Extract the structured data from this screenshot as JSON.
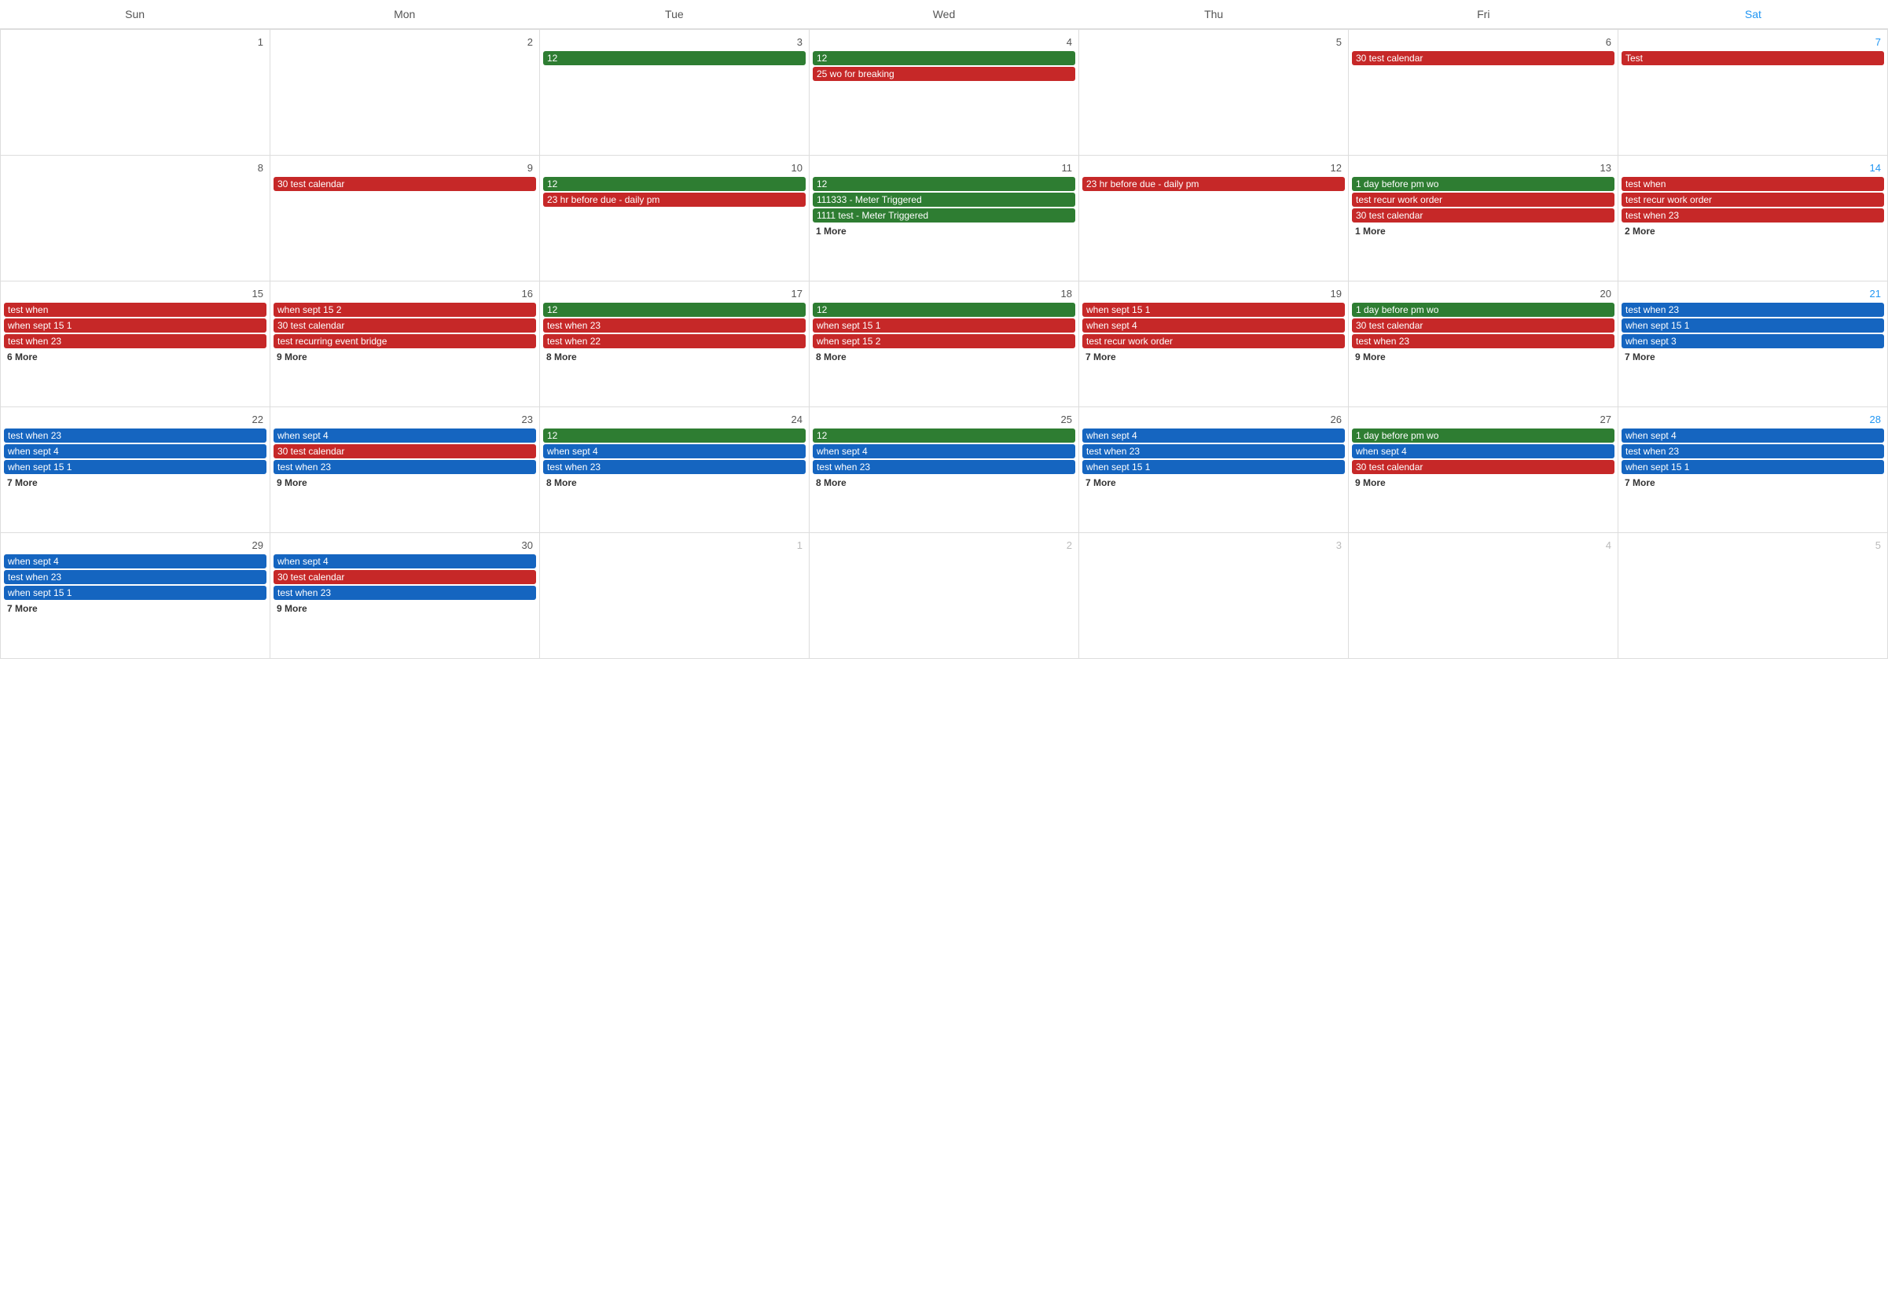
{
  "headers": [
    "Sun",
    "Mon",
    "Tue",
    "Wed",
    "Thu",
    "Fri",
    "Sat"
  ],
  "colors": {
    "green": "#2e7d32",
    "red": "#c62828",
    "blue": "#1565c0",
    "sat": "#2196F3"
  },
  "weeks": [
    {
      "days": [
        {
          "num": "1",
          "otherMonth": false,
          "events": [],
          "more": ""
        },
        {
          "num": "2",
          "otherMonth": false,
          "events": [],
          "more": ""
        },
        {
          "num": "3",
          "otherMonth": false,
          "events": [
            {
              "label": "12",
              "color": "green"
            }
          ],
          "more": ""
        },
        {
          "num": "4",
          "otherMonth": false,
          "events": [
            {
              "label": "12",
              "color": "green"
            },
            {
              "label": "25 wo for breaking",
              "color": "red"
            }
          ],
          "more": ""
        },
        {
          "num": "5",
          "otherMonth": false,
          "events": [],
          "more": ""
        },
        {
          "num": "6",
          "otherMonth": false,
          "events": [
            {
              "label": "30 test calendar",
              "color": "red"
            }
          ],
          "more": ""
        },
        {
          "num": "7",
          "otherMonth": false,
          "events": [
            {
              "label": "Test",
              "color": "red"
            }
          ],
          "more": "",
          "isSat": true
        }
      ]
    },
    {
      "days": [
        {
          "num": "8",
          "otherMonth": false,
          "events": [],
          "more": ""
        },
        {
          "num": "9",
          "otherMonth": false,
          "events": [
            {
              "label": "30 test calendar",
              "color": "red"
            }
          ],
          "more": ""
        },
        {
          "num": "10",
          "otherMonth": false,
          "events": [
            {
              "label": "12",
              "color": "green"
            },
            {
              "label": "23 hr before due - daily pm",
              "color": "red"
            }
          ],
          "more": ""
        },
        {
          "num": "11",
          "otherMonth": false,
          "events": [
            {
              "label": "12",
              "color": "green"
            },
            {
              "label": "111333 - Meter Triggered",
              "color": "green"
            },
            {
              "label": "1111 test - Meter Triggered",
              "color": "green"
            }
          ],
          "more": "1 More"
        },
        {
          "num": "12",
          "otherMonth": false,
          "events": [
            {
              "label": "23 hr before due - daily pm",
              "color": "red"
            }
          ],
          "more": ""
        },
        {
          "num": "13",
          "otherMonth": false,
          "events": [
            {
              "label": "1 day before pm wo",
              "color": "green"
            },
            {
              "label": "test recur work order",
              "color": "red"
            },
            {
              "label": "30 test calendar",
              "color": "red"
            }
          ],
          "more": "1 More"
        },
        {
          "num": "14",
          "otherMonth": false,
          "events": [
            {
              "label": "test when",
              "color": "red"
            },
            {
              "label": "test recur work order",
              "color": "red"
            },
            {
              "label": "test when 23",
              "color": "red"
            }
          ],
          "more": "2 More",
          "isSat": true
        }
      ]
    },
    {
      "days": [
        {
          "num": "15",
          "otherMonth": false,
          "events": [
            {
              "label": "test when",
              "color": "red"
            },
            {
              "label": "when sept 15 1",
              "color": "red"
            },
            {
              "label": "test when 23",
              "color": "red"
            }
          ],
          "more": "6 More"
        },
        {
          "num": "16",
          "otherMonth": false,
          "events": [
            {
              "label": "when sept 15 2",
              "color": "red"
            },
            {
              "label": "30 test calendar",
              "color": "red"
            },
            {
              "label": "test recurring event bridge",
              "color": "red"
            }
          ],
          "more": "9 More"
        },
        {
          "num": "17",
          "otherMonth": false,
          "events": [
            {
              "label": "12",
              "color": "green"
            },
            {
              "label": "test when 23",
              "color": "red"
            },
            {
              "label": "test when 22",
              "color": "red"
            }
          ],
          "more": "8 More"
        },
        {
          "num": "18",
          "otherMonth": false,
          "events": [
            {
              "label": "12",
              "color": "green"
            },
            {
              "label": "when sept 15 1",
              "color": "red"
            },
            {
              "label": "when sept 15 2",
              "color": "red"
            }
          ],
          "more": "8 More"
        },
        {
          "num": "19",
          "otherMonth": false,
          "events": [
            {
              "label": "when sept 15 1",
              "color": "red"
            },
            {
              "label": "when sept 4",
              "color": "red"
            },
            {
              "label": "test recur work order",
              "color": "red"
            }
          ],
          "more": "7 More"
        },
        {
          "num": "20",
          "otherMonth": false,
          "events": [
            {
              "label": "1 day before pm wo",
              "color": "green"
            },
            {
              "label": "30 test calendar",
              "color": "red"
            },
            {
              "label": "test when 23",
              "color": "red"
            }
          ],
          "more": "9 More"
        },
        {
          "num": "21",
          "otherMonth": false,
          "events": [
            {
              "label": "test when 23",
              "color": "blue"
            },
            {
              "label": "when sept 15 1",
              "color": "blue"
            },
            {
              "label": "when sept 3",
              "color": "blue"
            }
          ],
          "more": "7 More",
          "isSat": true
        }
      ]
    },
    {
      "days": [
        {
          "num": "22",
          "otherMonth": false,
          "events": [
            {
              "label": "test when 23",
              "color": "blue"
            },
            {
              "label": "when sept 4",
              "color": "blue"
            },
            {
              "label": "when sept 15 1",
              "color": "blue"
            }
          ],
          "more": "7 More"
        },
        {
          "num": "23",
          "otherMonth": false,
          "events": [
            {
              "label": "when sept 4",
              "color": "blue"
            },
            {
              "label": "30 test calendar",
              "color": "red"
            },
            {
              "label": "test when 23",
              "color": "blue"
            }
          ],
          "more": "9 More"
        },
        {
          "num": "24",
          "otherMonth": false,
          "events": [
            {
              "label": "12",
              "color": "green"
            },
            {
              "label": "when sept 4",
              "color": "blue"
            },
            {
              "label": "test when 23",
              "color": "blue"
            }
          ],
          "more": "8 More"
        },
        {
          "num": "25",
          "otherMonth": false,
          "events": [
            {
              "label": "12",
              "color": "green"
            },
            {
              "label": "when sept 4",
              "color": "blue"
            },
            {
              "label": "test when 23",
              "color": "blue"
            }
          ],
          "more": "8 More"
        },
        {
          "num": "26",
          "otherMonth": false,
          "events": [
            {
              "label": "when sept 4",
              "color": "blue"
            },
            {
              "label": "test when 23",
              "color": "blue"
            },
            {
              "label": "when sept 15 1",
              "color": "blue"
            }
          ],
          "more": "7 More"
        },
        {
          "num": "27",
          "otherMonth": false,
          "events": [
            {
              "label": "1 day before pm wo",
              "color": "green"
            },
            {
              "label": "when sept 4",
              "color": "blue"
            },
            {
              "label": "30 test calendar",
              "color": "red"
            }
          ],
          "more": "9 More"
        },
        {
          "num": "28",
          "otherMonth": false,
          "events": [
            {
              "label": "when sept 4",
              "color": "blue"
            },
            {
              "label": "test when 23",
              "color": "blue"
            },
            {
              "label": "when sept 15 1",
              "color": "blue"
            }
          ],
          "more": "7 More",
          "isSat": true
        }
      ]
    },
    {
      "days": [
        {
          "num": "29",
          "otherMonth": false,
          "events": [
            {
              "label": "when sept 4",
              "color": "blue"
            },
            {
              "label": "test when 23",
              "color": "blue"
            },
            {
              "label": "when sept 15 1",
              "color": "blue"
            }
          ],
          "more": "7 More"
        },
        {
          "num": "30",
          "otherMonth": false,
          "events": [
            {
              "label": "when sept 4",
              "color": "blue"
            },
            {
              "label": "30 test calendar",
              "color": "red"
            },
            {
              "label": "test when 23",
              "color": "blue"
            }
          ],
          "more": "9 More"
        },
        {
          "num": "1",
          "otherMonth": true,
          "events": [],
          "more": ""
        },
        {
          "num": "2",
          "otherMonth": true,
          "events": [],
          "more": ""
        },
        {
          "num": "3",
          "otherMonth": true,
          "events": [],
          "more": ""
        },
        {
          "num": "4",
          "otherMonth": true,
          "events": [],
          "more": ""
        },
        {
          "num": "5",
          "otherMonth": true,
          "events": [],
          "more": "",
          "isSat": true
        }
      ]
    }
  ]
}
